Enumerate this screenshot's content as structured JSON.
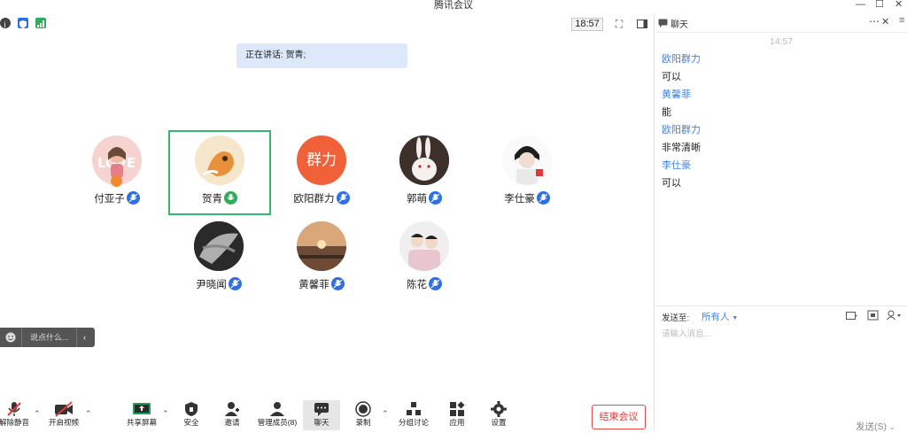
{
  "window": {
    "title": "腾讯会议"
  },
  "status": {
    "clock": "18:57"
  },
  "speaking": {
    "text": "正在讲话: 贺青;"
  },
  "participants": [
    {
      "name": "付亚子"
    },
    {
      "name": "贺青"
    },
    {
      "name": "欧阳群力",
      "avatar_text": "群力"
    },
    {
      "name": "郭萌"
    },
    {
      "name": "李仕豪"
    },
    {
      "name": "尹晓闻"
    },
    {
      "name": "黄馨菲"
    },
    {
      "name": "陈花"
    }
  ],
  "chat_input_pill": {
    "placeholder": "说点什么..."
  },
  "toolbar": {
    "unmute": "解除静音",
    "start_video": "开启视频",
    "share_screen": "共享屏幕",
    "security": "安全",
    "invite": "邀请",
    "manage_members": "管理成员(8)",
    "chat": "聊天",
    "record": "录制",
    "breakout": "分组讨论",
    "apps": "应用",
    "settings": "设置",
    "end_meeting": "结束会议"
  },
  "chat": {
    "title": "聊天",
    "time": "14:57",
    "messages": [
      {
        "sender": "欧阳群力",
        "text": "可以"
      },
      {
        "sender": "黄馨菲",
        "text": "能"
      },
      {
        "sender": "欧阳群力",
        "text": "非常清晰"
      },
      {
        "sender": "李仕豪",
        "text": "可以"
      }
    ],
    "send_to_label": "发送至:",
    "send_to_value": "所有人",
    "input_placeholder": "请输入消息...",
    "send_button": "发送(S)"
  },
  "colors": {
    "accent": "#3b82f0",
    "speaker_border": "#35b66b",
    "end": "#e03d3d"
  }
}
